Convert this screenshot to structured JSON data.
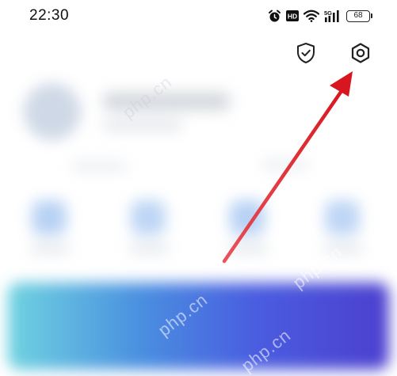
{
  "status_bar": {
    "time": "22:30",
    "battery_level": "68",
    "icons": [
      "alarm-icon",
      "hd-icon",
      "wifi-icon",
      "5g-signal-icon",
      "battery-icon"
    ]
  },
  "top_actions": {
    "security_icon": "shield-check-icon",
    "settings_icon": "settings-hexagon-icon"
  },
  "annotation": {
    "arrow_color": "#e0202a",
    "points_to": "settings-button"
  },
  "watermark": {
    "text": "php.cn"
  },
  "colors": {
    "banner_start": "#6fd3e0",
    "banner_end": "#4c3fcf"
  }
}
